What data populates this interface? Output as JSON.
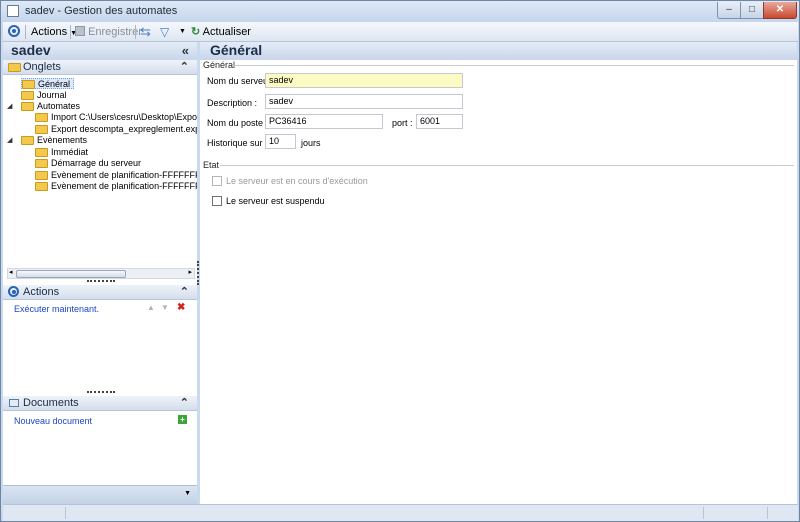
{
  "window": {
    "title": "sadev -  Gestion des automates"
  },
  "toolbar": {
    "actions_label": "Actions",
    "save_label": "Enregistrer",
    "refresh_label": "Actualiser"
  },
  "left": {
    "server_name": "sadev",
    "tabs_panel_title": "Onglets",
    "tree": [
      "Général",
      "Journal",
      "Automates",
      "Import C:\\Users\\cesru\\Desktop\\ExportAAA",
      "Export descompta_expreglement.exp",
      "Evènements",
      "Immédiat",
      "Démarrage du serveur",
      "Evènement de planification-FFFFFFFFFFFF",
      "Evènement de planification-FFFFFFFFFFFF"
    ],
    "actions_panel_title": "Actions",
    "actions_link": "Exécuter maintenant.",
    "documents_panel_title": "Documents",
    "documents_link": "Nouveau document"
  },
  "main": {
    "title": "Général",
    "group_general": "Général",
    "server_name_label": "Nom du serveur :",
    "server_name_value": "sadev",
    "description_label": "Description :",
    "description_value": "sadev",
    "host_label": "Nom du poste :",
    "host_value": "PC36416",
    "port_label": "port :",
    "port_value": "6001",
    "history_label": "Historique sur :",
    "history_value": "10",
    "history_unit": "jours",
    "group_state": "Etat",
    "running_label": "Le serveur est en cours d'exécution",
    "suspended_label": "Le serveur est suspendu"
  },
  "colors": {
    "accent": "#2a62b8",
    "link": "#1b46c9",
    "highlight_field": "#fdfbc4"
  }
}
